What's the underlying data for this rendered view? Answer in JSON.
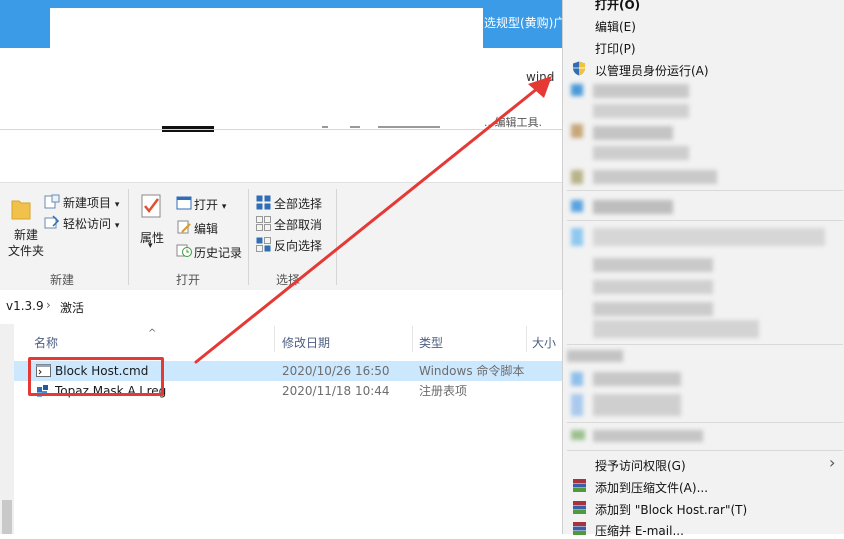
{
  "top": {
    "title_right": "选规型(黄购)广",
    "wind_text": "wind",
    "edit_tools_text": "...编辑工具."
  },
  "ribbon": {
    "new_folder_label": "新建\n文件夹",
    "new_item": "新建项目",
    "easy_access": "轻松访问",
    "new_group": "新建",
    "properties": "属性",
    "open": "打开",
    "edit": "编辑",
    "history": "历史记录",
    "open_group": "打开",
    "select_all": "全部选择",
    "select_none": "全部取消",
    "invert_select": "反向选择",
    "select_group": "选择"
  },
  "address": {
    "version": "v1.3.9",
    "separator": "›",
    "folder": "激活"
  },
  "file_list": {
    "columns": [
      "名称",
      "修改日期",
      "类型",
      "大小"
    ],
    "rows": [
      {
        "name": "Block Host.cmd",
        "date": "2020/10/26 16:50",
        "type": "Windows 命令脚本"
      },
      {
        "name": "Topaz Mask A.I.reg",
        "date": "2020/11/18 10:44",
        "type": "注册表项"
      }
    ]
  },
  "context_menu": {
    "items_top": [
      "打开(O)",
      "编辑(E)",
      "打印(P)",
      "以管理员身份运行(A)"
    ],
    "items_bottom": [
      "授予访问权限(G)",
      "添加到压缩文件(A)...",
      "添加到 \"Block Host.rar\"(T)",
      "压缩并 E-mail..."
    ],
    "submenu_arrow": "›"
  },
  "colors": {
    "accent": "#3c9be6",
    "selection": "#cce8ff",
    "annotation_red": "#e53935"
  }
}
